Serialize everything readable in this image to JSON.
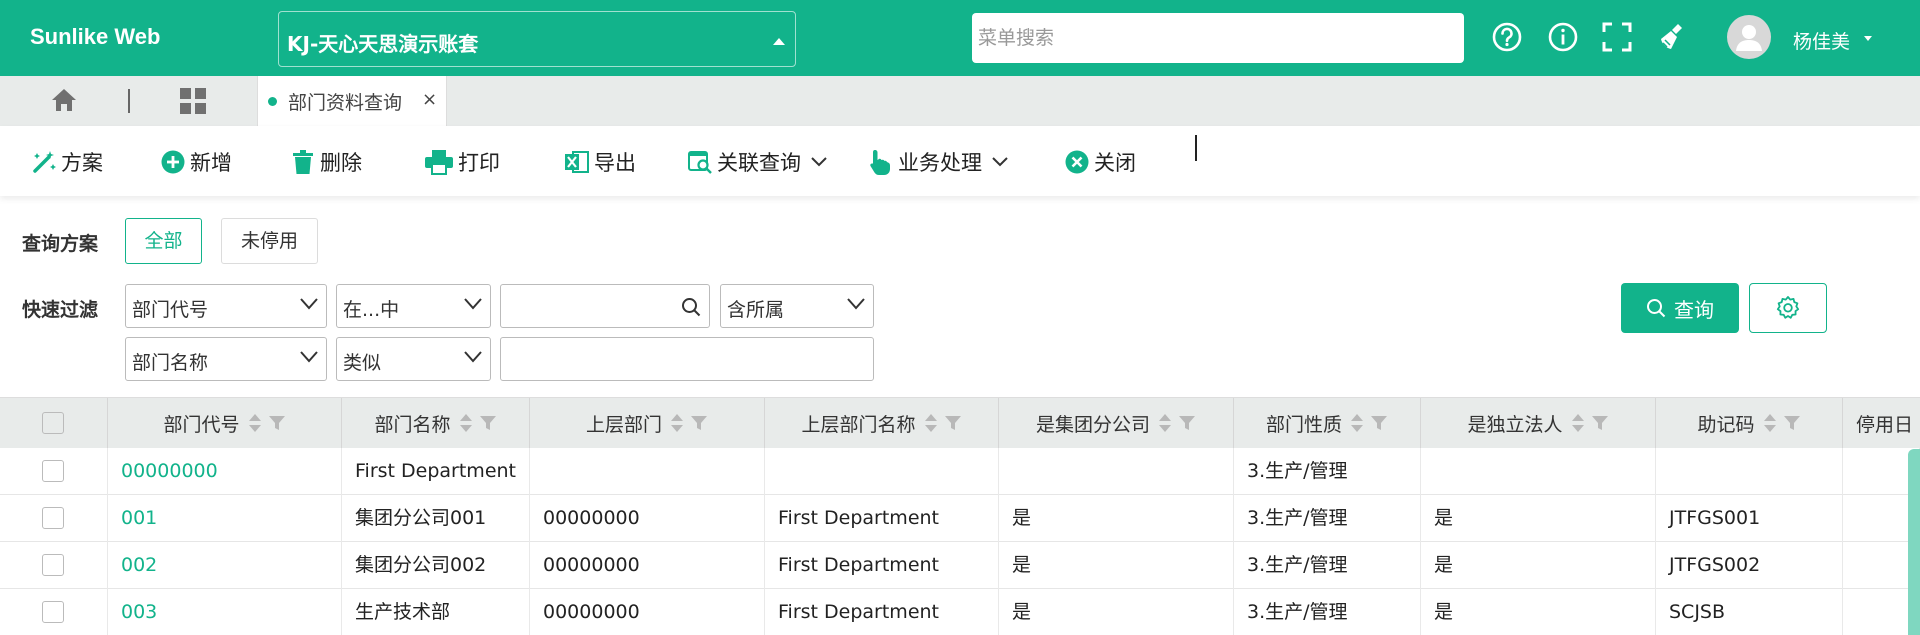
{
  "header": {
    "logo": "Sunlike Web",
    "account": "KJ-天心天思演示账套",
    "search_placeholder": "菜单搜索",
    "icons": [
      "help-icon",
      "info-icon",
      "fullscreen-icon",
      "clean-broom-icon"
    ],
    "username": "杨佳美"
  },
  "tabbar": {
    "tab_label": "部门资料查询",
    "close": "×"
  },
  "toolbar": {
    "plan": "方案",
    "add": "新增",
    "delete": "删除",
    "print": "打印",
    "export": "导出",
    "related_query": "关联查询",
    "business": "业务处理",
    "close": "关闭"
  },
  "filter": {
    "plan_label": "查询方案",
    "all": "全部",
    "unused": "未停用",
    "quick_label": "快速过滤",
    "row1": {
      "field": "部门代号",
      "op": "在...中",
      "scope": "含所属"
    },
    "row2": {
      "field": "部门名称",
      "op": "类似"
    },
    "query_btn": "查询"
  },
  "table": {
    "columns": [
      "部门代号",
      "部门名称",
      "上层部门",
      "上层部门名称",
      "是集团分公司",
      "部门性质",
      "是独立法人",
      "助记码",
      "停用日"
    ],
    "rows": [
      [
        "00000000",
        "First Department",
        "",
        "",
        "",
        "3.生产/管理",
        "",
        "",
        ""
      ],
      [
        "001",
        "集团分公司001",
        "00000000",
        "First Department",
        "是",
        "3.生产/管理",
        "是",
        "JTFGS001",
        ""
      ],
      [
        "002",
        "集团分公司002",
        "00000000",
        "First Department",
        "是",
        "3.生产/管理",
        "是",
        "JTFGS002",
        ""
      ],
      [
        "003",
        "生产技术部",
        "00000000",
        "First Department",
        "是",
        "3.生产/管理",
        "是",
        "SCJSB",
        ""
      ]
    ]
  },
  "colors": {
    "accent": "#12b38b"
  }
}
